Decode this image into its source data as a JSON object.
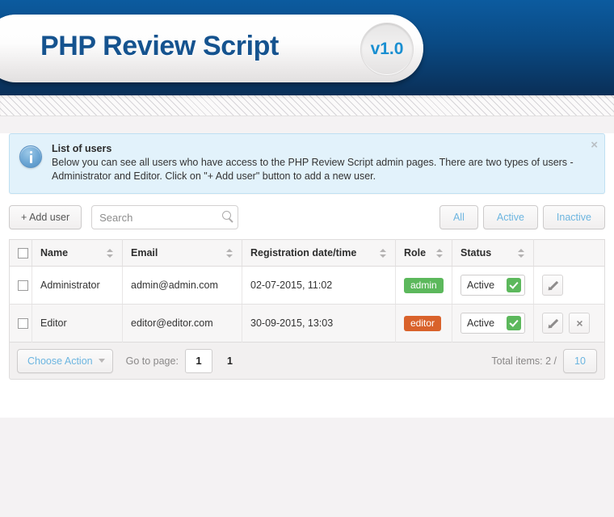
{
  "header": {
    "title": "PHP Review Script",
    "version": "v1.0"
  },
  "alert": {
    "title": "List of users",
    "text": "Below you can see all users who have access to the PHP Review Script admin pages. There are two types of users - Administrator and Editor. Click on \"+ Add user\" button to add a new user.",
    "close_label": "×",
    "icon": "info-circle-icon"
  },
  "toolbar": {
    "add_user_label": "+ Add user",
    "search_placeholder": "Search",
    "search_value": "",
    "search_icon": "search-icon",
    "filters": [
      {
        "label": "All"
      },
      {
        "label": "Active"
      },
      {
        "label": "Inactive"
      }
    ]
  },
  "table": {
    "headers": {
      "name": "Name",
      "email": "Email",
      "registration": "Registration date/time",
      "role": "Role",
      "status": "Status"
    },
    "rows": [
      {
        "name": "Administrator",
        "email": "admin@admin.com",
        "registration": "02-07-2015, 11:02",
        "role": "admin",
        "status": "Active"
      },
      {
        "name": "Editor",
        "email": "editor@editor.com",
        "registration": "30-09-2015, 13:03",
        "role": "editor",
        "status": "Active"
      }
    ]
  },
  "footer": {
    "choose_action_label": "Choose Action",
    "goto_page_label": "Go to page:",
    "page_value": "1",
    "page_total": "1",
    "total_items_label": "Total items: 2 /",
    "per_page": "10"
  },
  "colors": {
    "header_top": "#0c5b9f",
    "header_bottom": "#0a2f57",
    "title": "#15538f",
    "version": "#1a8fd1",
    "link": "#6cb5e0",
    "badge_admin": "#5cb85c",
    "badge_editor": "#d9622b",
    "alert_bg": "#e2f2fb"
  }
}
